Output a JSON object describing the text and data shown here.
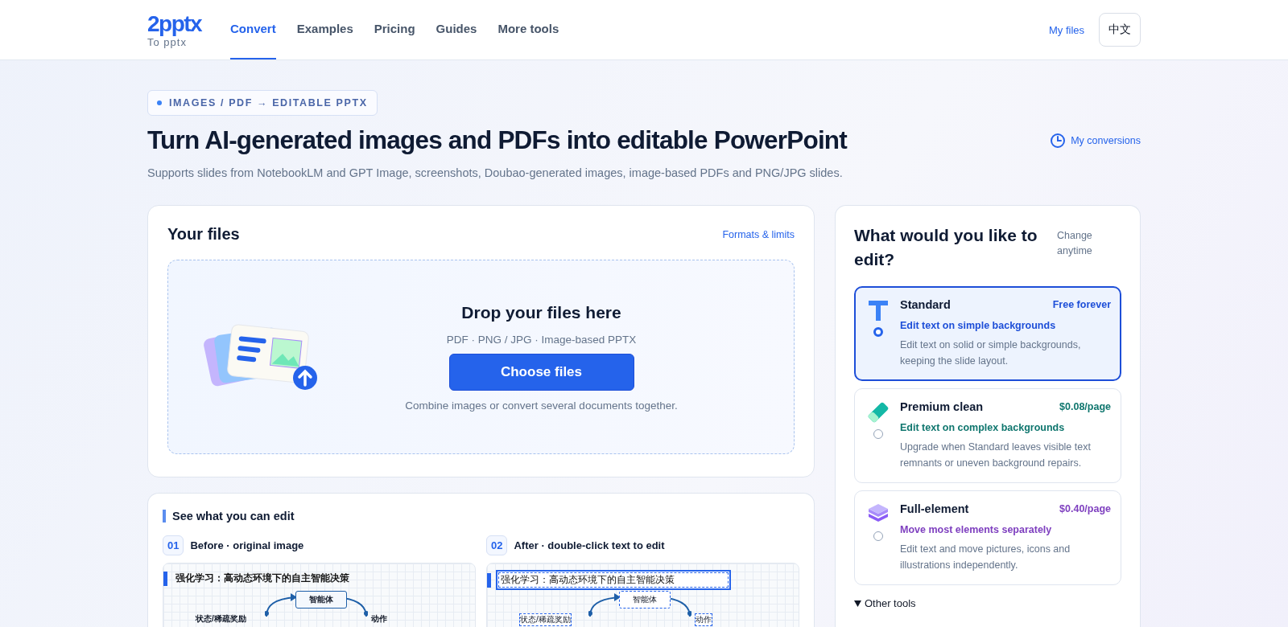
{
  "header": {
    "logo": "2pptx",
    "logo_sub": "To pptx",
    "nav": [
      {
        "label": "Convert",
        "selected": true
      },
      {
        "label": "Examples",
        "selected": false
      },
      {
        "label": "Pricing",
        "selected": false
      },
      {
        "label": "Guides",
        "selected": false
      },
      {
        "label": "More tools",
        "selected": false
      }
    ],
    "my_files": "My files",
    "language": "中文"
  },
  "hero": {
    "badge": "IMAGES / PDF → EDITABLE PPTX",
    "title": "Turn AI-generated images and PDFs into editable PowerPoint",
    "history_link": "My conversions",
    "subtitle": "Supports slides from NotebookLM and GPT Image, screenshots, Doubao-generated images, image-based PDFs and PNG/JPG slides."
  },
  "upload": {
    "title": "Your files",
    "limits_link": "Formats & limits",
    "drop_title": "Drop your files here",
    "formats": "PDF · PNG / JPG · Image-based PPTX",
    "button": "Choose files",
    "hint": "Combine images or convert several documents together."
  },
  "examples": {
    "title": "See what you can edit",
    "panels": [
      {
        "number": "01",
        "label": "Before · original image",
        "kind": "before",
        "slide_title": "强化学习：高动态环境下的自主智能决策",
        "node": "智能体",
        "left_label": "状态/稀疏奖励",
        "right_label": "动作"
      },
      {
        "number": "02",
        "label": "After · double-click text to edit",
        "kind": "after",
        "slide_title": "强化学习：高动态环境下的自主智能决策",
        "node": "智能体",
        "left_label": "状态/稀疏奖励",
        "right_label": "动作"
      }
    ]
  },
  "modes": {
    "title": "What would you like to edit?",
    "note": "Change anytime",
    "options": [
      {
        "kind": "text",
        "name": "Standard",
        "price": "Free forever",
        "tagline": "Edit text on simple backgrounds",
        "description": "Edit text on solid or simple backgrounds, keeping the slide layout.",
        "color": "#1d4ed8",
        "selected": true
      },
      {
        "kind": "eraser",
        "name": "Premium clean",
        "price": "$0.08/page",
        "tagline": "Edit text on complex backgrounds",
        "description": "Upgrade when Standard leaves visible text remnants or uneven background repairs.",
        "color": "#0f766e",
        "selected": false
      },
      {
        "kind": "layers",
        "name": "Full-element",
        "price": "$0.40/page",
        "tagline": "Move most elements separately",
        "description": "Edit text and move pictures, icons and illustrations independently.",
        "color": "#7e3fbf",
        "selected": false
      }
    ],
    "other_tools": "Other tools"
  }
}
